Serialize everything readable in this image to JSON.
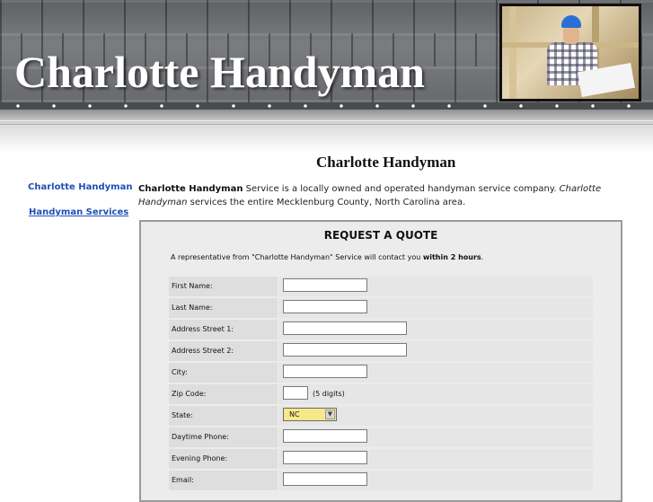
{
  "header": {
    "site_title": "Charlotte Handyman"
  },
  "sidebar": {
    "items": [
      {
        "label": "Charlotte Handyman"
      },
      {
        "label": "Handyman Services"
      }
    ]
  },
  "main": {
    "heading": "Charlotte Handyman",
    "intro": {
      "brand": "Charlotte Handyman",
      "text1": " Service is a locally owned and operated handyman service company.  ",
      "brand_italic": "Charlotte Handyman",
      "text2": " services the entire Mecklenburg County, North Carolina area."
    }
  },
  "quote_form": {
    "title": "REQUEST A QUOTE",
    "note_prefix": "A representative from \"Charlotte Handyman\" Service will contact you ",
    "note_bold": "within 2 hours",
    "note_suffix": ".",
    "fields": {
      "first_name": {
        "label": "First Name:",
        "value": ""
      },
      "last_name": {
        "label": "Last Name:",
        "value": ""
      },
      "address1": {
        "label": "Address Street 1:",
        "value": ""
      },
      "address2": {
        "label": "Address Street 2:",
        "value": ""
      },
      "city": {
        "label": "City:",
        "value": ""
      },
      "zip": {
        "label": "Zip Code:",
        "value": "",
        "hint": "(5 digits)"
      },
      "state": {
        "label": "State:",
        "value": "NC"
      },
      "daytime_phone": {
        "label": "Daytime Phone:",
        "value": ""
      },
      "evening_phone": {
        "label": "Evening Phone:",
        "value": ""
      },
      "email": {
        "label": "Email:",
        "value": ""
      }
    }
  },
  "colors": {
    "link": "#1f4fb8",
    "state_select_bg": "#f7e98a"
  }
}
